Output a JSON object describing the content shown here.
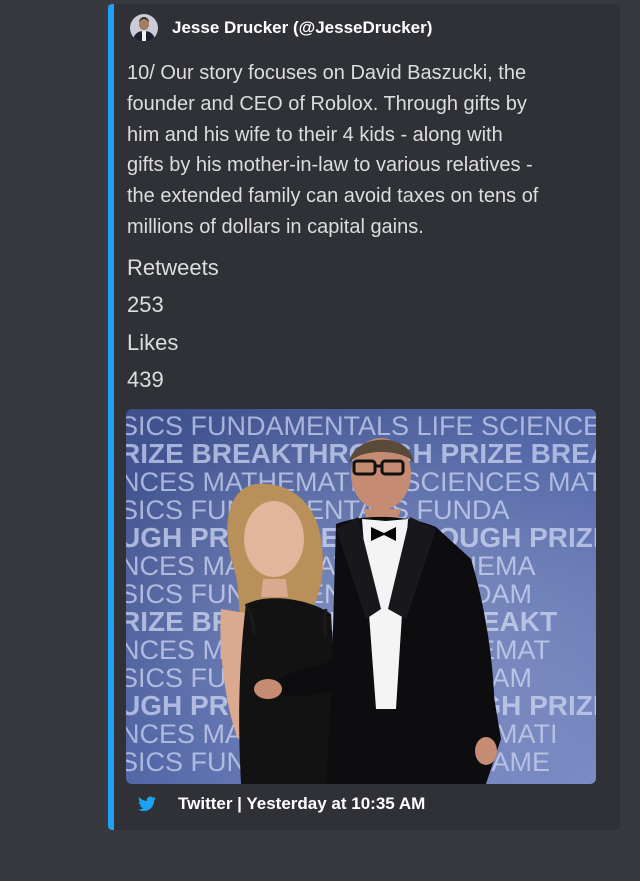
{
  "author": {
    "name": "Jesse Drucker (@JesseDrucker)",
    "avatar_icon": "profile-photo"
  },
  "tweet": {
    "text": "10/ Our story focuses on David Baszucki, the\nfounder and CEO of Roblox. Through gifts by\nhim and his wife to their 4 kids - along with\ngifts by his mother-in-law to various relatives -\nthe extended family can avoid taxes on tens of\nmillions of dollars in capital gains."
  },
  "fields": [
    {
      "name": "Retweets",
      "value": "253"
    },
    {
      "name": "Likes",
      "value": "439"
    }
  ],
  "photo": {
    "backdrop_text": [
      "SICS FUNDAMENTALS LIFE SCIENCES MATHEM",
      "RIZE BREAKTHROUGH PRIZE BREAK",
      "NCES MATHEMATICS SCIENCES MATHEMA",
      "SICS FUNDAMENTALS FUNDA",
      "UGH PRIZE BREAKTHROUGH PRIZE B",
      "NCES MATHEMATICS MATHEMA",
      "SICS FUNDAMENTALS FUNDAM",
      "RIZE BREAKTHROUGH BREAKT",
      "NCES MATHEMATICS MATHEMAT",
      "SICS FUNDAMENTALS FUNDAM",
      "UGH PRIZE BREAKTHROUGH PRIZE BR",
      "NCES MATHEMATICS MATHEMATI",
      "SICS FUNDAMENTALS FUNDAME"
    ]
  },
  "footer": {
    "icon": "twitter-bird-icon",
    "text": "Twitter | Yesterday at 10:35 AM",
    "accent_color": "#1da1f2"
  },
  "colors": {
    "background": "#37393f",
    "embed_background": "#2f3136",
    "embed_border": "#1da1f2"
  }
}
